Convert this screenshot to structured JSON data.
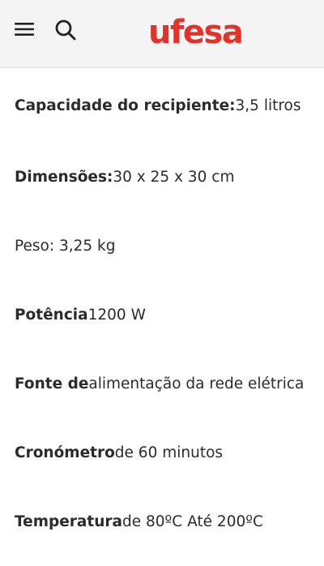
{
  "header": {
    "logo_text": "ufesa",
    "brand_color": "#e4322b",
    "menu_icon": "hamburger-menu-icon",
    "search_icon": "search-icon"
  },
  "specs": [
    {
      "label": "Capacidade do recipiente:",
      "value": " 3,5 litros"
    },
    {
      "label": "Dimensões:",
      "value": " 30 x 25 x 30 cm"
    },
    {
      "label": "Peso",
      "value": " : 3,25 kg"
    },
    {
      "label": "Potência",
      "value": " 1200 W"
    },
    {
      "label": "Fonte de",
      "value": " alimentação da rede elétrica"
    },
    {
      "label": "Cronómetro",
      "value": " de 60 minutos"
    },
    {
      "label": "Temperatura",
      "value": " de 80ºC Até 200ºC"
    }
  ]
}
